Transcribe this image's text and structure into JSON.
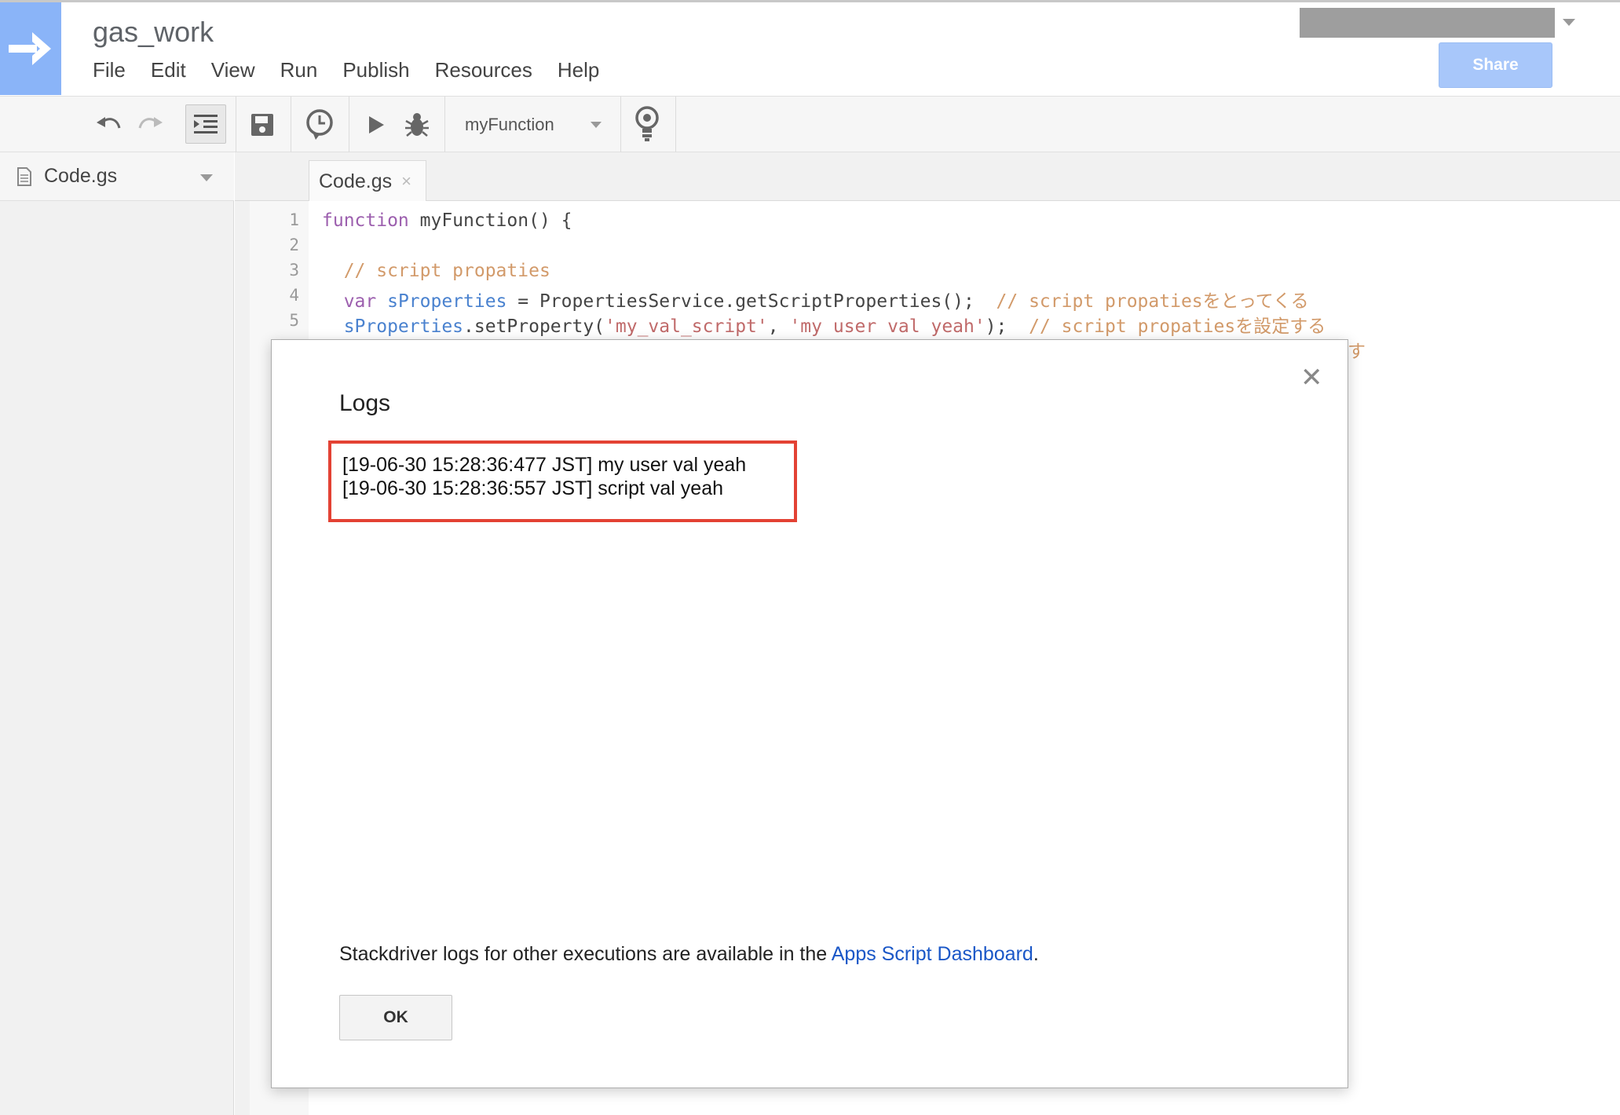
{
  "header": {
    "project_title": "gas_work",
    "menu": [
      "File",
      "Edit",
      "View",
      "Run",
      "Publish",
      "Resources",
      "Help"
    ],
    "share_label": "Share"
  },
  "toolbar": {
    "selected_function": "myFunction"
  },
  "sidebar": {
    "files": [
      {
        "name": "Code.gs"
      }
    ]
  },
  "editor": {
    "active_tab": "Code.gs",
    "tab_close": "×",
    "line_numbers": [
      "1",
      "2",
      "3",
      "4",
      "5"
    ],
    "lines": {
      "l1_kw": "function",
      "l1_rest": " myFunction() {",
      "l3_cm": "  // script propaties",
      "l4_kw": "  var",
      "l4_var": " sProperties",
      "l4_rest": " = PropertiesService.getScriptProperties();  ",
      "l4_cm": "// script propatiesをとってくる",
      "l5_var": "  sProperties",
      "l5_rest1": ".setProperty(",
      "l5_str1": "'my_val_script'",
      "l5_rest2": ", ",
      "l5_str2": "'my user val yeah'",
      "l5_rest3": ");  ",
      "l5_cm": "// script propatiesを設定する",
      "l6_cm": "す"
    }
  },
  "logs_dialog": {
    "title": "Logs",
    "close_glyph": "✕",
    "entries": [
      "[19-06-30 15:28:36:477 JST] my user val yeah",
      "[19-06-30 15:28:36:557 JST] script val yeah"
    ],
    "footnote_text": "Stackdriver logs for other executions are available in the ",
    "footnote_link": "Apps Script Dashboard",
    "footnote_end": ".",
    "ok_label": "OK"
  },
  "colors": {
    "highlight_border": "#e34234",
    "link": "#1a57c7",
    "logo_bg": "#8ab4f8",
    "share_bg": "#a8c7fa"
  },
  "icons": [
    "arrow-logo-icon",
    "undo-icon",
    "redo-icon",
    "indent-icon",
    "save-icon",
    "triggers-icon",
    "run-icon",
    "debug-icon",
    "lightbulb-icon",
    "file-icon",
    "close-icon"
  ]
}
